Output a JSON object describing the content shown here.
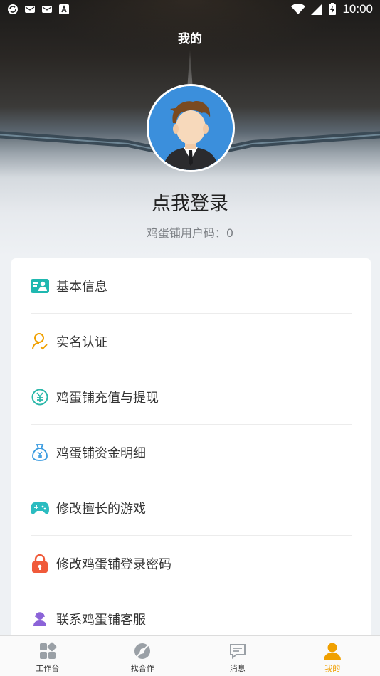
{
  "status_bar": {
    "time": "10:00"
  },
  "header": {
    "title": "我的"
  },
  "profile": {
    "login_prompt": "点我登录",
    "user_code": "鸡蛋铺用户码：0"
  },
  "menu": {
    "items": [
      {
        "label": "基本信息",
        "icon": "id-card-icon",
        "color": "#1fb8b0"
      },
      {
        "label": "实名认证",
        "icon": "user-verify-icon",
        "color": "#f0a000"
      },
      {
        "label": "鸡蛋铺充值与提现",
        "icon": "yuan-coin-icon",
        "color": "#2ab7a9"
      },
      {
        "label": "鸡蛋铺资金明细",
        "icon": "money-bag-icon",
        "color": "#3a9be0"
      },
      {
        "label": "修改擅长的游戏",
        "icon": "gamepad-icon",
        "color": "#2bbcc0"
      },
      {
        "label": "修改鸡蛋铺登录密码",
        "icon": "lock-icon",
        "color": "#f05a3a"
      },
      {
        "label": "联系鸡蛋铺客服",
        "icon": "customer-service-icon",
        "color": "#8b63d8"
      }
    ]
  },
  "tabbar": {
    "tabs": [
      {
        "label": "工作台",
        "icon": "dashboard-icon"
      },
      {
        "label": "找合作",
        "icon": "compass-icon"
      },
      {
        "label": "消息",
        "icon": "message-icon"
      },
      {
        "label": "我的",
        "icon": "person-icon",
        "active": true
      }
    ],
    "active_color": "#f0a000"
  }
}
